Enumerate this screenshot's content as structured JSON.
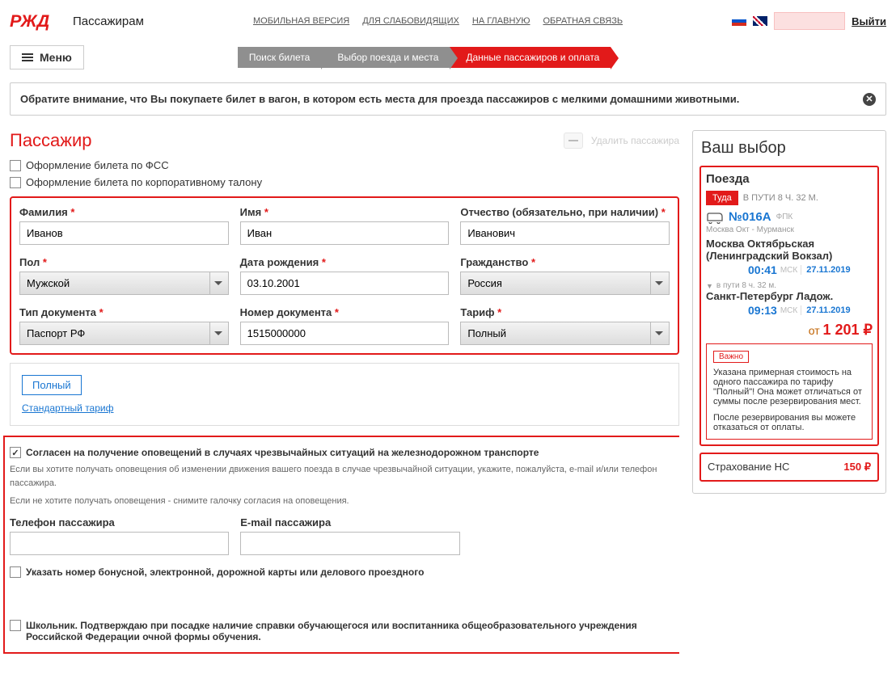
{
  "header": {
    "brand": "Пассажирам",
    "links": {
      "mobile": "МОБИЛЬНАЯ ВЕРСИЯ",
      "accessibility": "ДЛЯ СЛАБОВИДЯЩИХ",
      "home": "НА ГЛАВНУЮ",
      "feedback": "ОБРАТНАЯ СВЯЗЬ"
    },
    "logout": "Выйти",
    "menu_label": "Меню"
  },
  "breadcrumb": {
    "step1": "Поиск билета",
    "step2": "Выбор поезда и места",
    "step3": "Данные пассажиров и оплата"
  },
  "notice": "Обратите внимание, что Вы покупаете билет в вагон, в котором есть места для проезда пассажиров с мелкими домашними животными.",
  "passenger": {
    "title": "Пассажир",
    "delete_label": "Удалить пассажира",
    "fss_label": "Оформление билета по ФСС",
    "corp_label": "Оформление билета по корпоративному талону",
    "fields": {
      "lastname_label": "Фамилия",
      "lastname_value": "Иванов",
      "firstname_label": "Имя",
      "firstname_value": "Иван",
      "middlename_label": "Отчество (обязательно, при наличии)",
      "middlename_value": "Иванович",
      "gender_label": "Пол",
      "gender_value": "Мужской",
      "dob_label": "Дата рождения",
      "dob_value": "03.10.2001",
      "citizenship_label": "Гражданство",
      "citizenship_value": "Россия",
      "doctype_label": "Тип документа",
      "doctype_value": "Паспорт РФ",
      "docnum_label": "Номер документа",
      "docnum_value": "1515000000",
      "tariff_label": "Тариф",
      "tariff_value": "Полный"
    },
    "tariff_tab": "Полный",
    "tariff_std": "Стандартный тариф",
    "consent_label": "Согласен на получение оповещений в случаях чрезвычайных ситуаций на железнодорожном транспорте",
    "consent_hint1": "Если вы хотите получать оповещения об изменении движения вашего поезда в случае чрезвычайной ситуации, укажите, пожалуйста, e-mail и/или телефон пассажира.",
    "consent_hint2": "Если не хотите получать оповещения - снимите галочку согласия на оповещения.",
    "phone_label": "Телефон пассажира",
    "email_label": "E-mail пассажира",
    "bonus_label": "Указать номер бонусной, электронной, дорожной карты или делового проездного",
    "school_label": "Школьник. Подтверждаю при посадке наличие справки обучающегося или воспитанника общеобразовательного учреждения Российской Федерации очной формы обучения."
  },
  "sidebar": {
    "title": "Ваш выбор",
    "trains_label": "Поезда",
    "direction_badge": "Туда",
    "total_duration": "В ПУТИ 8 Ч. 32 М.",
    "train_number": "№016А",
    "carrier": "ФПК",
    "route": "Москва Окт - Мурманск",
    "from_station": "Москва Октябрьская (Ленинградский Вокзал)",
    "depart_time": "00:41",
    "tz": "МСК",
    "depart_date": "27.11.2019",
    "leg_duration": "в пути  8 ч. 32 м.",
    "to_station": "Санкт-Петербург Ладож.",
    "arrive_time": "09:13",
    "arrive_date": "27.11.2019",
    "price_from": "от",
    "price_value": "1 201 ₽",
    "warn_badge": "Важно",
    "warn_text1": "Указана примерная стоимость на одного пассажира по тарифу \"Полный\"! Она может отличаться от суммы после резервирования мест.",
    "warn_text2": "После резервирования вы можете отказаться от оплаты.",
    "insurance_label": "Страхование НС",
    "insurance_price": "150 ₽"
  }
}
